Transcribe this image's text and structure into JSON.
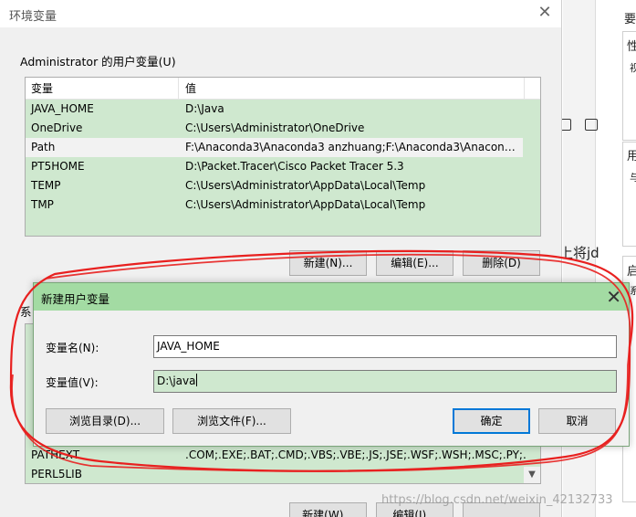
{
  "main_dialog": {
    "title": "环境变量",
    "user_group_label": "Administrator 的用户变量(U)",
    "columns": [
      "变量",
      "值"
    ],
    "rows": [
      {
        "name": "JAVA_HOME",
        "value": "D:\\Java"
      },
      {
        "name": "OneDrive",
        "value": "C:\\Users\\Administrator\\OneDrive"
      },
      {
        "name": "Path",
        "value": "F:\\Anaconda3\\Anaconda3 anzhuang;F:\\Anaconda3\\Anaconda..."
      },
      {
        "name": "PT5HOME",
        "value": "D:\\Packet.Tracer\\Cisco Packet Tracer 5.3"
      },
      {
        "name": "TEMP",
        "value": "C:\\Users\\Administrator\\AppData\\Local\\Temp"
      },
      {
        "name": "TMP",
        "value": "C:\\Users\\Administrator\\AppData\\Local\\Temp"
      }
    ],
    "buttons": {
      "new": "新建(N)...",
      "edit": "编辑(E)...",
      "delete": "删除(D)"
    },
    "system_group_label": "系",
    "system_rows": [
      {
        "name": "PATHEXT",
        "value": ".COM;.EXE;.BAT;.CMD;.VBS;.VBE;.JS;.JSE;.WSF;.WSH;.MSC;.PY;.P..."
      },
      {
        "name": "PERL5LIB",
        "value": ""
      }
    ],
    "bottom_buttons": {
      "new": "新建(W)...",
      "edit": "编辑(I)..."
    }
  },
  "new_dialog": {
    "title": "新建用户变量",
    "name_label": "变量名(N):",
    "name_value": "JAVA_HOME",
    "value_label": "变量值(V):",
    "value_value": "D:\\java",
    "browse_dir": "浏览目录(D)...",
    "browse_file": "浏览文件(F)...",
    "ok": "确定",
    "cancel": "取消"
  },
  "background_window": {
    "texts": [
      "要",
      "性",
      "视",
      "用",
      "与",
      "启",
      "系",
      "上将jd"
    ]
  },
  "watermark": "https://blog.csdn.net/weixin_42132733",
  "colors": {
    "selection_green": "#cfe8cf",
    "dialog_title_green": "#a3dba3",
    "annotation_red": "#e8201f",
    "primary_button_border": "#0078d7"
  }
}
